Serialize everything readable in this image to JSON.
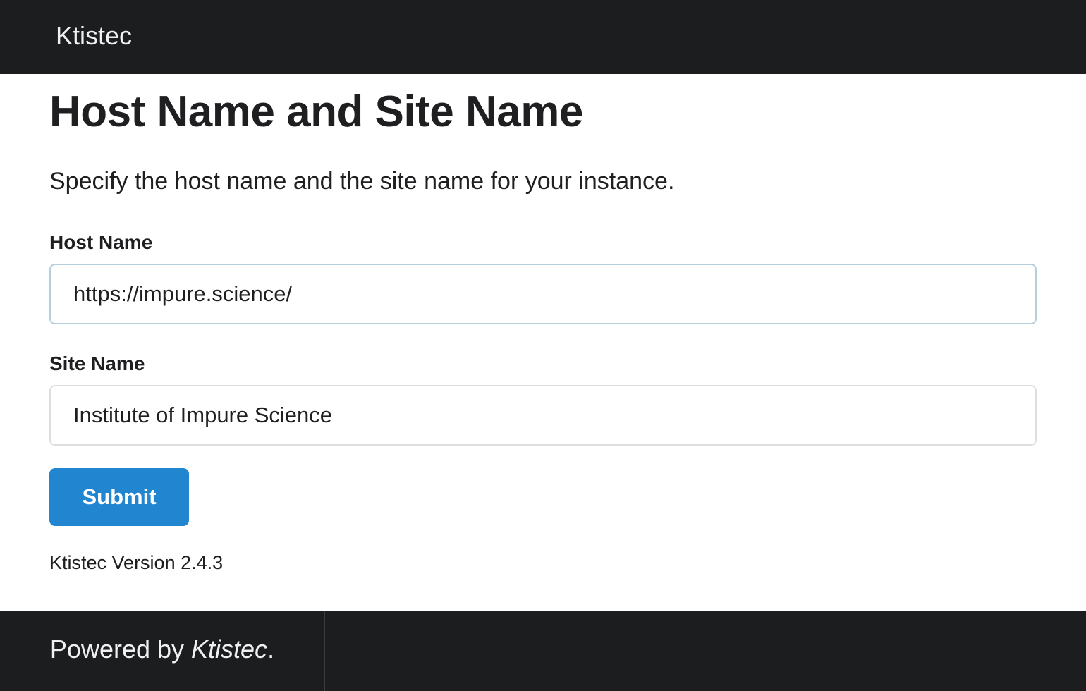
{
  "header": {
    "brand": "Ktistec"
  },
  "main": {
    "title": "Host Name and Site Name",
    "description": "Specify the host name and the site name for your instance.",
    "host_name": {
      "label": "Host Name",
      "value": "https://impure.science/"
    },
    "site_name": {
      "label": "Site Name",
      "value": "Institute of Impure Science"
    },
    "submit_label": "Submit",
    "version": "Ktistec Version 2.4.3"
  },
  "footer": {
    "prefix": "Powered by ",
    "link": "Ktistec",
    "suffix": "."
  },
  "colors": {
    "bar_background": "#1c1d1f",
    "primary_button": "#2185d0",
    "focused_input_border": "#b5cedc"
  }
}
